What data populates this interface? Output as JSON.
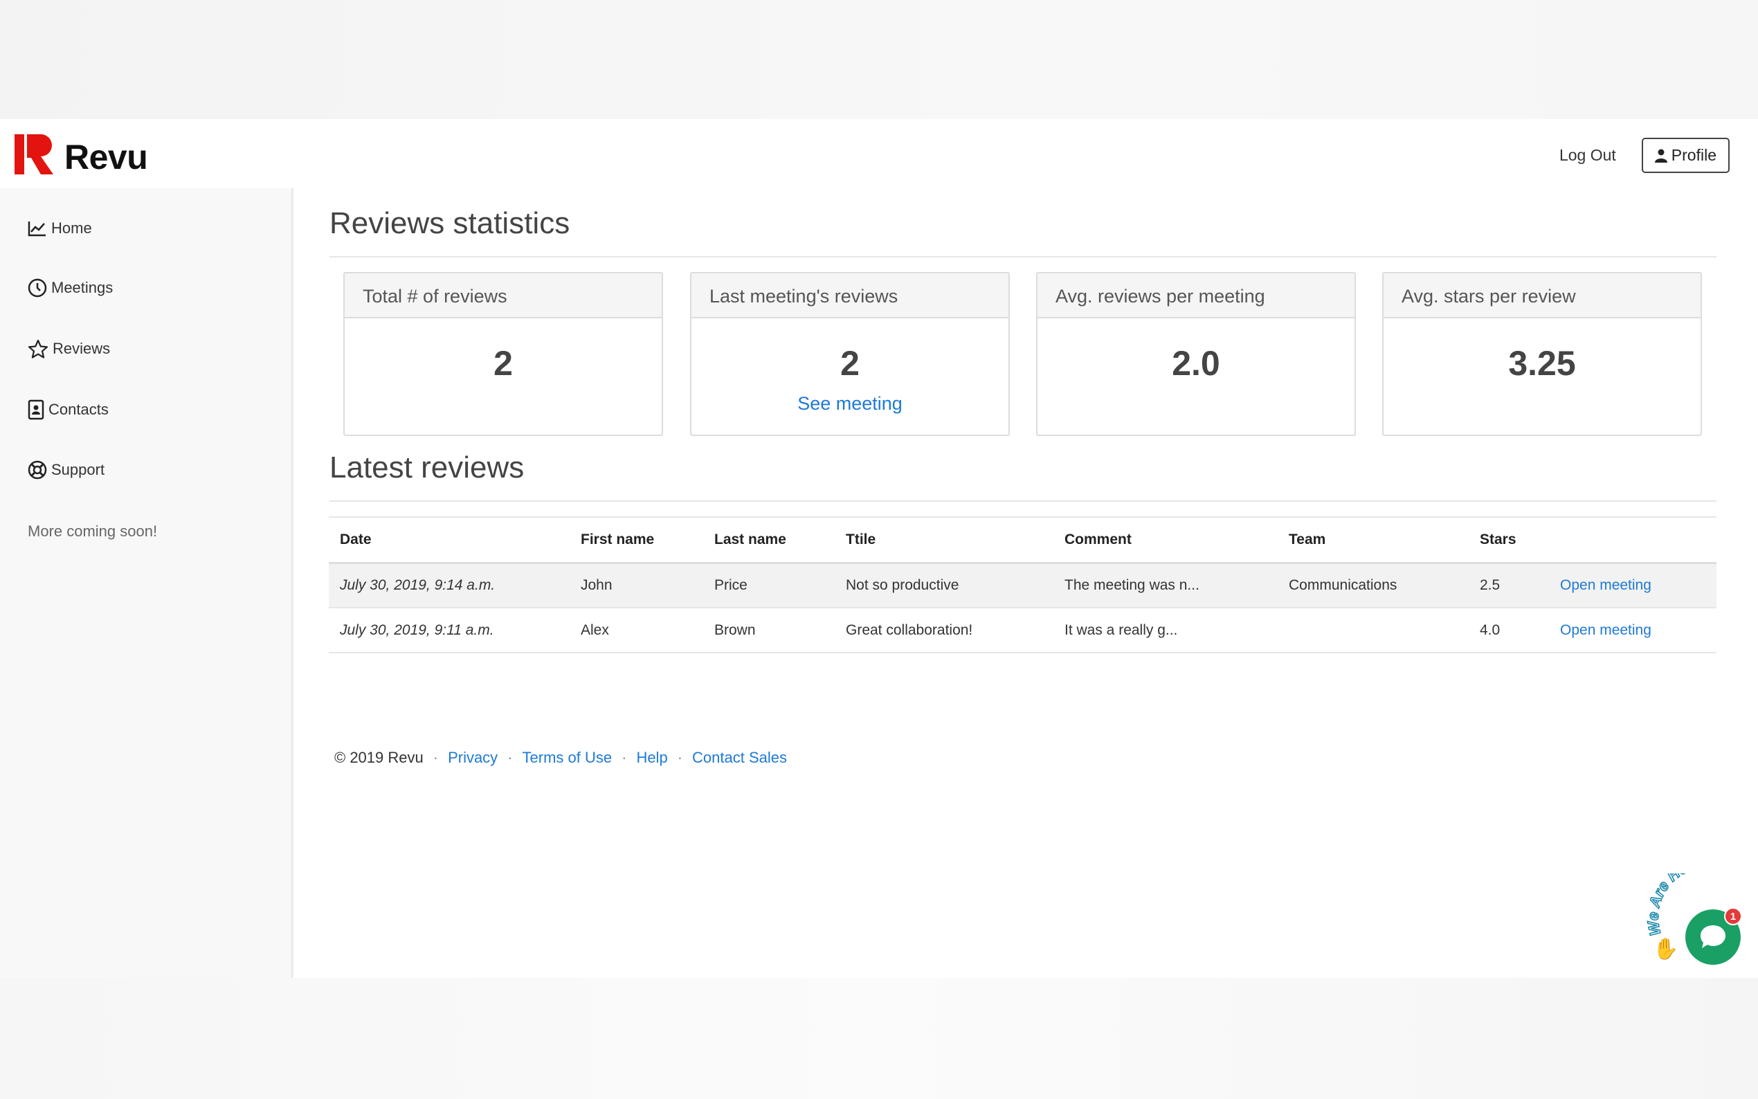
{
  "brand": {
    "name": "Revu",
    "accent": "#e3140f"
  },
  "navbar": {
    "logout": "Log Out",
    "profile": "Profile"
  },
  "sidebar": {
    "items": [
      {
        "label": "Home",
        "icon": "chart-line-icon"
      },
      {
        "label": "Meetings",
        "icon": "clock-icon"
      },
      {
        "label": "Reviews",
        "icon": "star-icon"
      },
      {
        "label": "Contacts",
        "icon": "contact-card-icon"
      },
      {
        "label": "Support",
        "icon": "life-ring-icon"
      }
    ],
    "note": "More coming soon!"
  },
  "stats": {
    "title": "Reviews statistics",
    "cards": [
      {
        "label": "Total # of reviews",
        "value": "2"
      },
      {
        "label": "Last meeting's reviews",
        "value": "2",
        "link": "See meeting"
      },
      {
        "label": "Avg. reviews per meeting",
        "value": "2.0"
      },
      {
        "label": "Avg. stars per review",
        "value": "3.25"
      }
    ]
  },
  "latest": {
    "title": "Latest reviews",
    "columns": [
      "Date",
      "First name",
      "Last name",
      "Ttile",
      "Comment",
      "Team",
      "Stars",
      ""
    ],
    "rows": [
      {
        "date": "July 30, 2019, 9:14 a.m.",
        "first": "John",
        "last": "Price",
        "title": "Not so productive",
        "comment": "The meeting was n...",
        "team": "Communications",
        "stars": "2.5",
        "action": "Open meeting"
      },
      {
        "date": "July 30, 2019, 9:11 a.m.",
        "first": "Alex",
        "last": "Brown",
        "title": "Great collaboration!",
        "comment": "It was a really g...",
        "team": "",
        "stars": "4.0",
        "action": "Open meeting"
      }
    ]
  },
  "footer": {
    "copyright": "© 2019 Revu",
    "links": [
      "Privacy",
      "Terms of Use",
      "Help",
      "Contact Sales"
    ]
  },
  "chat": {
    "badge": "1",
    "banner": "We Are Here!",
    "color": "#1aa064"
  },
  "colors": {
    "link": "#1e7ad6",
    "text": "#333333"
  }
}
